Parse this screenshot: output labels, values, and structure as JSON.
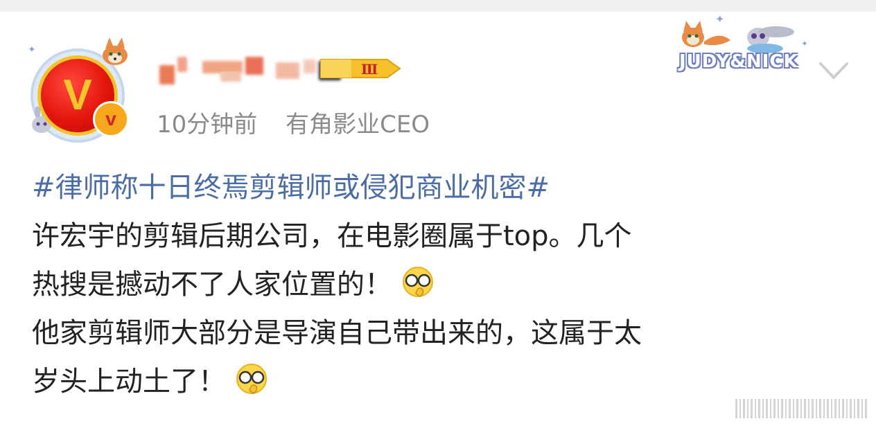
{
  "post": {
    "author": {
      "meta_time": "10分钟前",
      "meta_source": "有角影业CEO",
      "avatar_letter": "V",
      "verified_badge_letter": "v",
      "level_badge": "Ⅲ"
    },
    "sticker_text": "JUDY&NICK",
    "content": {
      "hashtag": "#律师称十日终焉剪辑师或侵犯商业机密#",
      "lines": [
        "许宏宇的剪辑后期公司，在电影圈属于top。几个",
        "热搜是撼动不了人家位置的！",
        "他家剪辑师大部分是导演自己带出来的，这属于太",
        "岁头上动土了！"
      ],
      "emoji_name": "facepalm-emoji"
    },
    "icons": {
      "dropdown": "chevron-down-icon",
      "more": "more-icon"
    },
    "colors": {
      "hashtag": "#4b6da5",
      "text": "#222222",
      "meta": "#8a8a8a",
      "badge": "#f5c02a"
    }
  }
}
